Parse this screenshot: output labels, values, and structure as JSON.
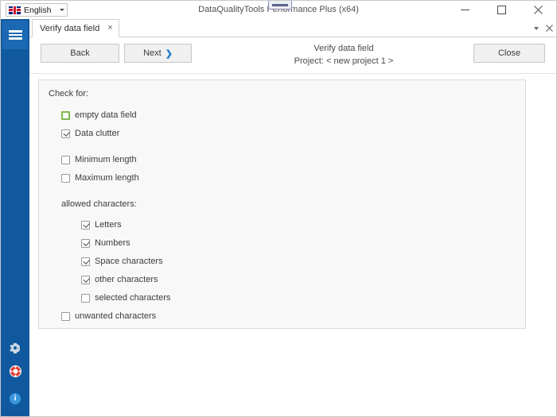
{
  "window": {
    "title": "DataQualityTools Performance Plus (x64)",
    "minimize_label": "minimize",
    "maximize_label": "maximize",
    "close_label": "close"
  },
  "language": {
    "label": "English",
    "flag": "uk-flag-icon"
  },
  "tabs": [
    {
      "label": "Verify data field",
      "close": "×"
    }
  ],
  "tabstrip": {
    "overflow": "tab-list-caret",
    "close_all": "✕"
  },
  "toolbar": {
    "back_label": "Back",
    "next_label": "Next",
    "next_chevron": "❯",
    "close_label": "Close"
  },
  "header": {
    "title": "Verify data field",
    "project": "Project: < new project 1 >"
  },
  "panel": {
    "title": "Check for:",
    "group_label": "allowed characters:",
    "checks": [
      {
        "label": "empty data field",
        "checked": false,
        "focused": true,
        "indent": 1
      },
      {
        "label": "Data clutter",
        "checked": true,
        "focused": false,
        "indent": 1
      },
      {
        "label": "Minimum length",
        "checked": false,
        "focused": false,
        "indent": 1
      },
      {
        "label": "Maximum length",
        "checked": false,
        "focused": false,
        "indent": 1
      },
      {
        "label": "Letters",
        "checked": true,
        "focused": false,
        "indent": 2
      },
      {
        "label": "Numbers",
        "checked": true,
        "focused": false,
        "indent": 2
      },
      {
        "label": "Space characters",
        "checked": true,
        "focused": false,
        "indent": 2
      },
      {
        "label": "other characters",
        "checked": true,
        "focused": false,
        "indent": 2
      },
      {
        "label": "selected characters",
        "checked": false,
        "focused": false,
        "indent": 2
      },
      {
        "label": "unwanted characters",
        "checked": false,
        "focused": false,
        "indent": 1
      }
    ]
  },
  "sidebar": {
    "menu": "hamburger-menu",
    "icons": [
      {
        "name": "settings-gear-icon"
      },
      {
        "name": "life-ring-support-icon"
      },
      {
        "name": "info-icon",
        "glyph": "i"
      }
    ]
  },
  "colors": {
    "sidebar": "#10599e",
    "accent": "#1e7fd4",
    "focus_green": "#7fb850",
    "panel_bg": "#f8f8f8",
    "info_blue": "#3a96dd",
    "support_red": "#e03a2f"
  }
}
